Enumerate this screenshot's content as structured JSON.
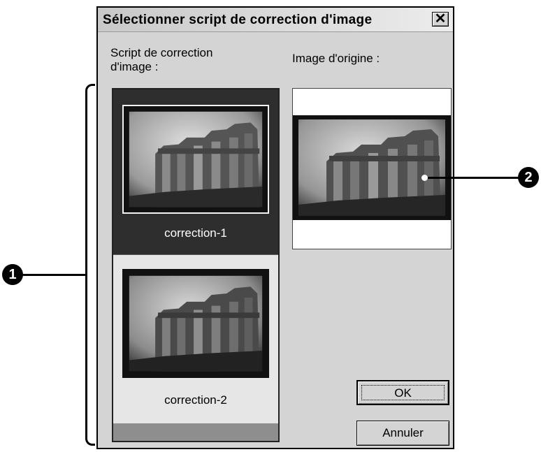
{
  "dialog": {
    "title": "Sélectionner script de correction d'image",
    "close_glyph": "✕"
  },
  "labels": {
    "script_list": "Script de correction d'image :",
    "original_image": "Image d'origine :"
  },
  "script_list": {
    "items": [
      {
        "label": "correction-1",
        "selected": true
      },
      {
        "label": "correction-2",
        "selected": false
      }
    ]
  },
  "buttons": {
    "ok": "OK",
    "cancel": "Annuler"
  },
  "callouts": {
    "one": "1",
    "two": "2"
  },
  "colors": {
    "selection": "#2e2e2e",
    "dialog_bg": "#d4d4d4"
  }
}
